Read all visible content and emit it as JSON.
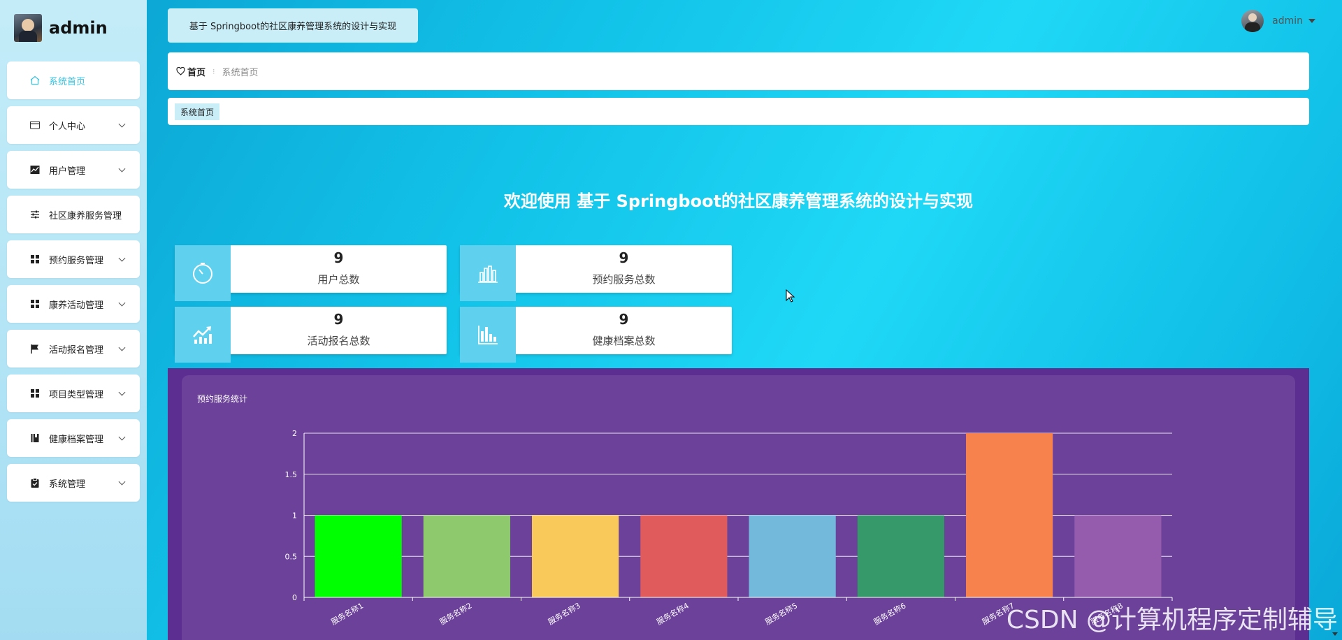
{
  "brand": {
    "name": "admin"
  },
  "sidebar": {
    "items": [
      {
        "label": "系统首页",
        "icon": "home-icon",
        "active": true,
        "expandable": false
      },
      {
        "label": "个人中心",
        "icon": "id-card-icon",
        "active": false,
        "expandable": true
      },
      {
        "label": "用户管理",
        "icon": "chart-area-icon",
        "active": false,
        "expandable": true
      },
      {
        "label": "社区康养服务管理",
        "icon": "sliders-icon",
        "active": false,
        "expandable": false
      },
      {
        "label": "预约服务管理",
        "icon": "grid-icon",
        "active": false,
        "expandable": true
      },
      {
        "label": "康养活动管理",
        "icon": "grid-icon",
        "active": false,
        "expandable": true
      },
      {
        "label": "活动报名管理",
        "icon": "flag-icon",
        "active": false,
        "expandable": true
      },
      {
        "label": "项目类型管理",
        "icon": "grid-icon",
        "active": false,
        "expandable": true
      },
      {
        "label": "健康档案管理",
        "icon": "book-icon",
        "active": false,
        "expandable": true
      },
      {
        "label": "系统管理",
        "icon": "clipboard-icon",
        "active": false,
        "expandable": true
      }
    ]
  },
  "header": {
    "title": "基于 Springboot的社区康养管理系统的设计与实现",
    "user": "admin"
  },
  "breadcrumb": {
    "home": "首页",
    "separator": "⁝",
    "current": "系统首页"
  },
  "tags": {
    "active": "系统首页"
  },
  "welcome": "欢迎使用 基于 Springboot的社区康养管理系统的设计与实现",
  "stats": [
    {
      "value": "9",
      "label": "用户总数",
      "icon": "timer-icon"
    },
    {
      "value": "9",
      "label": "预约服务总数",
      "icon": "bar-chart-icon"
    },
    {
      "value": "9",
      "label": "活动报名总数",
      "icon": "trend-up-icon"
    },
    {
      "value": "9",
      "label": "健康档案总数",
      "icon": "column-chart-icon"
    }
  ],
  "chart_data": {
    "type": "bar",
    "title": "预约服务统计",
    "categories": [
      "服务名称1",
      "服务名称2",
      "服务名称3",
      "服务名称4",
      "服务名称5",
      "服务名称6",
      "服务名称7",
      "服务名称8"
    ],
    "values": [
      1,
      1,
      1,
      1,
      1,
      1,
      2,
      1
    ],
    "colors": [
      "#00ff00",
      "#8ec96e",
      "#f9c95a",
      "#e05b5b",
      "#73b9dc",
      "#35996a",
      "#f8824e",
      "#955bad"
    ],
    "yticks": [
      "0",
      "0.5",
      "1",
      "1.5",
      "2"
    ],
    "ylim": [
      0,
      2
    ],
    "grid": true,
    "xlabel": "",
    "ylabel": ""
  },
  "watermark": "CSDN @计算机程序定制辅导"
}
